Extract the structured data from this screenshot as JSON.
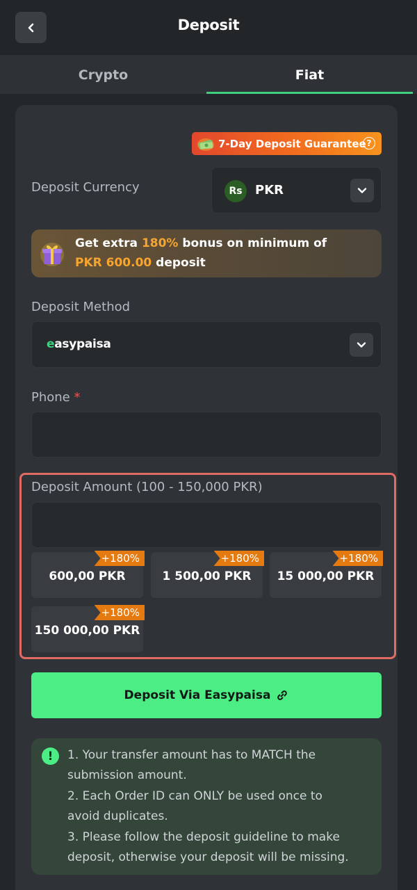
{
  "header": {
    "title": "Deposit"
  },
  "tabs": [
    {
      "label": "Crypto"
    },
    {
      "label": "Fiat"
    }
  ],
  "promo": {
    "guarantee_label": "7-Day Deposit Guarantee",
    "help_glyph": "?"
  },
  "currency": {
    "label": "Deposit Currency",
    "badge": "Rs",
    "value": "PKR"
  },
  "bonus": {
    "prefix": "Get extra ",
    "percent": "180%",
    "middle": " bonus on minimum of",
    "amount": "PKR 600.00",
    "suffix": " deposit"
  },
  "method": {
    "label": "Deposit Method",
    "value_prefix": "e",
    "value_rest": "asypaisa"
  },
  "phone": {
    "label": "Phone",
    "required_mark": "*",
    "value": ""
  },
  "amount": {
    "label": "Deposit Amount (100 - 150,000 PKR)",
    "value": "",
    "presets": [
      {
        "amount": "600,00 PKR",
        "bonus": "+180%"
      },
      {
        "amount": "1 500,00 PKR",
        "bonus": "+180%"
      },
      {
        "amount": "15 000,00 PKR",
        "bonus": "+180%"
      },
      {
        "amount": "150 000,00 PKR",
        "bonus": "+180%"
      }
    ]
  },
  "submit": {
    "label": "Deposit Via Easypaisa"
  },
  "notice": {
    "icon": "!",
    "lines": [
      "1. Your transfer amount has to MATCH the",
      "submission amount.",
      "2. Each Order ID can ONLY be used once to",
      "avoid duplicates.",
      "3. Please follow the deposit guideline to make",
      "deposit, otherwise your deposit will be missing."
    ]
  },
  "colors": {
    "accent": "#4ded85",
    "highlight": "#f7a531",
    "frame": "#e06b63"
  }
}
